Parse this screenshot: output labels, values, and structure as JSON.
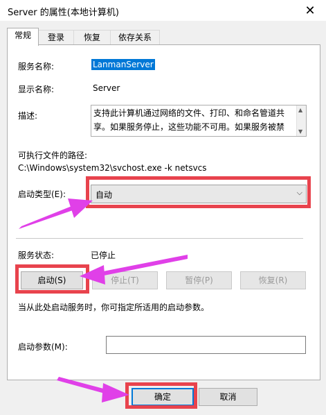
{
  "window": {
    "title": "Server 的属性(本地计算机)",
    "close_glyph": "✕"
  },
  "tabs": [
    {
      "label": "常规",
      "active": true
    },
    {
      "label": "登录",
      "active": false
    },
    {
      "label": "恢复",
      "active": false
    },
    {
      "label": "依存关系",
      "active": false
    }
  ],
  "general": {
    "service_name_label": "服务名称:",
    "service_name_value": "LanmanServer",
    "display_name_label": "显示名称:",
    "display_name_value": "Server",
    "description_label": "描述:",
    "description_text": "支持此计算机通过网络的文件、打印、和命名管道共享。如果服务停止，这些功能不可用。如果服务被禁用，",
    "path_label": "可执行文件的路径:",
    "path_value": "C:\\Windows\\system32\\svchost.exe -k netsvcs",
    "startup_type_label": "启动类型(E):",
    "startup_type_value": "自动",
    "status_label": "服务状态:",
    "status_value": "已停止",
    "buttons": {
      "start": "启动(S)",
      "stop": "停止(T)",
      "pause": "暂停(P)",
      "resume": "恢复(R)"
    },
    "hint": "当从此处启动服务时，你可指定所适用的启动参数。",
    "params_label": "启动参数(M):",
    "params_value": ""
  },
  "footer": {
    "ok": "确定",
    "cancel": "取消"
  },
  "colors": {
    "highlight_red": "#e8434d",
    "annotation_arrow": "#e040e8",
    "selection": "#0078d7"
  }
}
